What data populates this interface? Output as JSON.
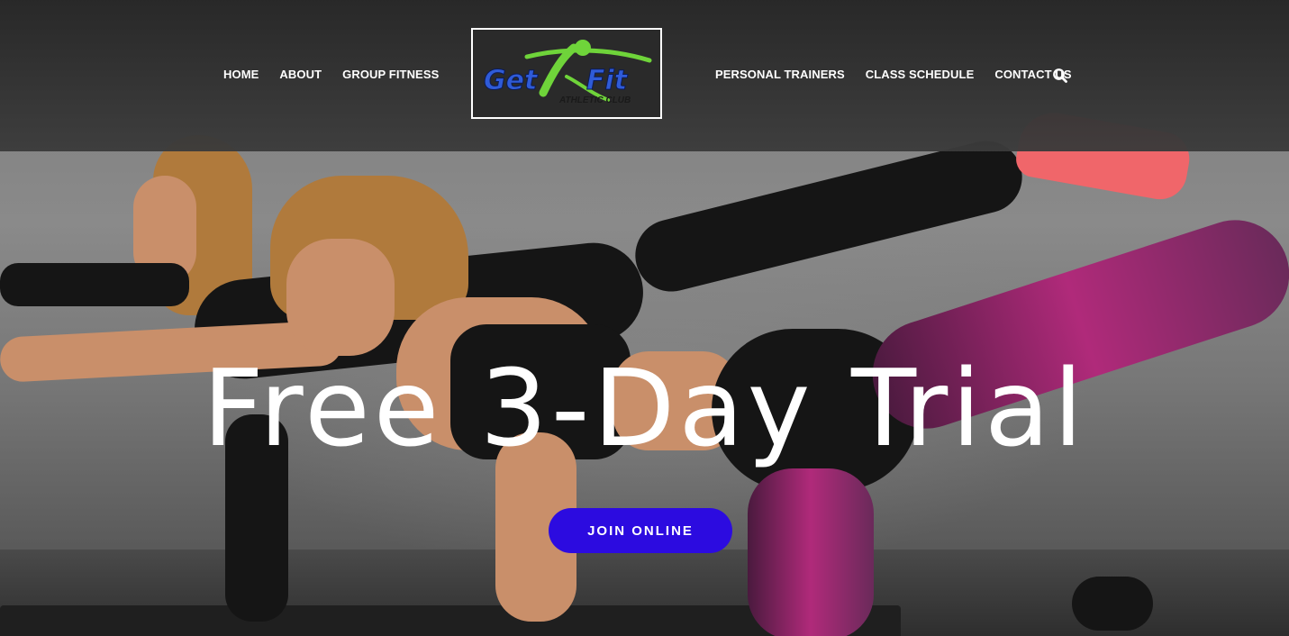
{
  "header": {
    "nav_left": [
      "HOME",
      "ABOUT",
      "GROUP FITNESS"
    ],
    "nav_right": [
      "PERSONAL TRAINERS",
      "CLASS SCHEDULE",
      "CONTACT US"
    ],
    "search_icon": "search-icon",
    "logo": {
      "text_main_1": "Get",
      "text_main_2": "Fit",
      "text_sub": "ATHLETIC CLUB",
      "colors": {
        "blue": "#2f5bd8",
        "green": "#6fd43a",
        "border": "#ffffff"
      }
    }
  },
  "hero": {
    "headline": "Free 3-Day Trial",
    "cta_label": "JOIN ONLINE",
    "cta_color": "#2c0be0"
  }
}
